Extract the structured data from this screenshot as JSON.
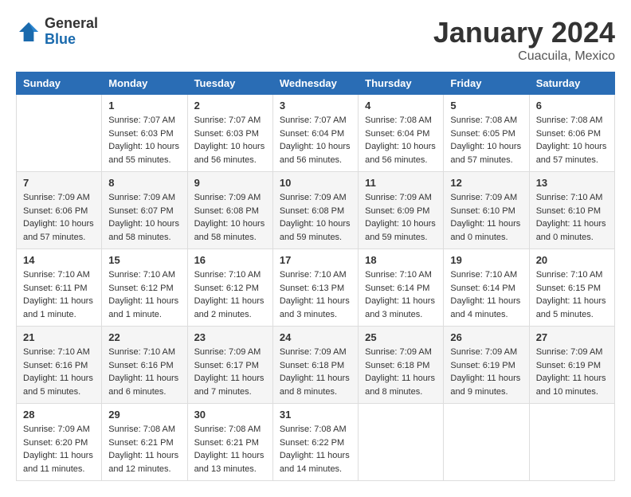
{
  "header": {
    "logo_general": "General",
    "logo_blue": "Blue",
    "month_title": "January 2024",
    "subtitle": "Cuacuila, Mexico"
  },
  "days_of_week": [
    "Sunday",
    "Monday",
    "Tuesday",
    "Wednesday",
    "Thursday",
    "Friday",
    "Saturday"
  ],
  "weeks": [
    [
      {
        "day": "",
        "sunrise": "",
        "sunset": "",
        "daylight": ""
      },
      {
        "day": "1",
        "sunrise": "7:07 AM",
        "sunset": "6:03 PM",
        "daylight": "10 hours and 55 minutes."
      },
      {
        "day": "2",
        "sunrise": "7:07 AM",
        "sunset": "6:03 PM",
        "daylight": "10 hours and 56 minutes."
      },
      {
        "day": "3",
        "sunrise": "7:07 AM",
        "sunset": "6:04 PM",
        "daylight": "10 hours and 56 minutes."
      },
      {
        "day": "4",
        "sunrise": "7:08 AM",
        "sunset": "6:04 PM",
        "daylight": "10 hours and 56 minutes."
      },
      {
        "day": "5",
        "sunrise": "7:08 AM",
        "sunset": "6:05 PM",
        "daylight": "10 hours and 57 minutes."
      },
      {
        "day": "6",
        "sunrise": "7:08 AM",
        "sunset": "6:06 PM",
        "daylight": "10 hours and 57 minutes."
      }
    ],
    [
      {
        "day": "7",
        "sunrise": "7:09 AM",
        "sunset": "6:06 PM",
        "daylight": "10 hours and 57 minutes."
      },
      {
        "day": "8",
        "sunrise": "7:09 AM",
        "sunset": "6:07 PM",
        "daylight": "10 hours and 58 minutes."
      },
      {
        "day": "9",
        "sunrise": "7:09 AM",
        "sunset": "6:08 PM",
        "daylight": "10 hours and 58 minutes."
      },
      {
        "day": "10",
        "sunrise": "7:09 AM",
        "sunset": "6:08 PM",
        "daylight": "10 hours and 59 minutes."
      },
      {
        "day": "11",
        "sunrise": "7:09 AM",
        "sunset": "6:09 PM",
        "daylight": "10 hours and 59 minutes."
      },
      {
        "day": "12",
        "sunrise": "7:09 AM",
        "sunset": "6:10 PM",
        "daylight": "11 hours and 0 minutes."
      },
      {
        "day": "13",
        "sunrise": "7:10 AM",
        "sunset": "6:10 PM",
        "daylight": "11 hours and 0 minutes."
      }
    ],
    [
      {
        "day": "14",
        "sunrise": "7:10 AM",
        "sunset": "6:11 PM",
        "daylight": "11 hours and 1 minute."
      },
      {
        "day": "15",
        "sunrise": "7:10 AM",
        "sunset": "6:12 PM",
        "daylight": "11 hours and 1 minute."
      },
      {
        "day": "16",
        "sunrise": "7:10 AM",
        "sunset": "6:12 PM",
        "daylight": "11 hours and 2 minutes."
      },
      {
        "day": "17",
        "sunrise": "7:10 AM",
        "sunset": "6:13 PM",
        "daylight": "11 hours and 3 minutes."
      },
      {
        "day": "18",
        "sunrise": "7:10 AM",
        "sunset": "6:14 PM",
        "daylight": "11 hours and 3 minutes."
      },
      {
        "day": "19",
        "sunrise": "7:10 AM",
        "sunset": "6:14 PM",
        "daylight": "11 hours and 4 minutes."
      },
      {
        "day": "20",
        "sunrise": "7:10 AM",
        "sunset": "6:15 PM",
        "daylight": "11 hours and 5 minutes."
      }
    ],
    [
      {
        "day": "21",
        "sunrise": "7:10 AM",
        "sunset": "6:16 PM",
        "daylight": "11 hours and 5 minutes."
      },
      {
        "day": "22",
        "sunrise": "7:10 AM",
        "sunset": "6:16 PM",
        "daylight": "11 hours and 6 minutes."
      },
      {
        "day": "23",
        "sunrise": "7:09 AM",
        "sunset": "6:17 PM",
        "daylight": "11 hours and 7 minutes."
      },
      {
        "day": "24",
        "sunrise": "7:09 AM",
        "sunset": "6:18 PM",
        "daylight": "11 hours and 8 minutes."
      },
      {
        "day": "25",
        "sunrise": "7:09 AM",
        "sunset": "6:18 PM",
        "daylight": "11 hours and 8 minutes."
      },
      {
        "day": "26",
        "sunrise": "7:09 AM",
        "sunset": "6:19 PM",
        "daylight": "11 hours and 9 minutes."
      },
      {
        "day": "27",
        "sunrise": "7:09 AM",
        "sunset": "6:19 PM",
        "daylight": "11 hours and 10 minutes."
      }
    ],
    [
      {
        "day": "28",
        "sunrise": "7:09 AM",
        "sunset": "6:20 PM",
        "daylight": "11 hours and 11 minutes."
      },
      {
        "day": "29",
        "sunrise": "7:08 AM",
        "sunset": "6:21 PM",
        "daylight": "11 hours and 12 minutes."
      },
      {
        "day": "30",
        "sunrise": "7:08 AM",
        "sunset": "6:21 PM",
        "daylight": "11 hours and 13 minutes."
      },
      {
        "day": "31",
        "sunrise": "7:08 AM",
        "sunset": "6:22 PM",
        "daylight": "11 hours and 14 minutes."
      },
      {
        "day": "",
        "sunrise": "",
        "sunset": "",
        "daylight": ""
      },
      {
        "day": "",
        "sunrise": "",
        "sunset": "",
        "daylight": ""
      },
      {
        "day": "",
        "sunrise": "",
        "sunset": "",
        "daylight": ""
      }
    ]
  ],
  "labels": {
    "sunrise_prefix": "Sunrise: ",
    "sunset_prefix": "Sunset: ",
    "daylight_prefix": "Daylight: "
  }
}
